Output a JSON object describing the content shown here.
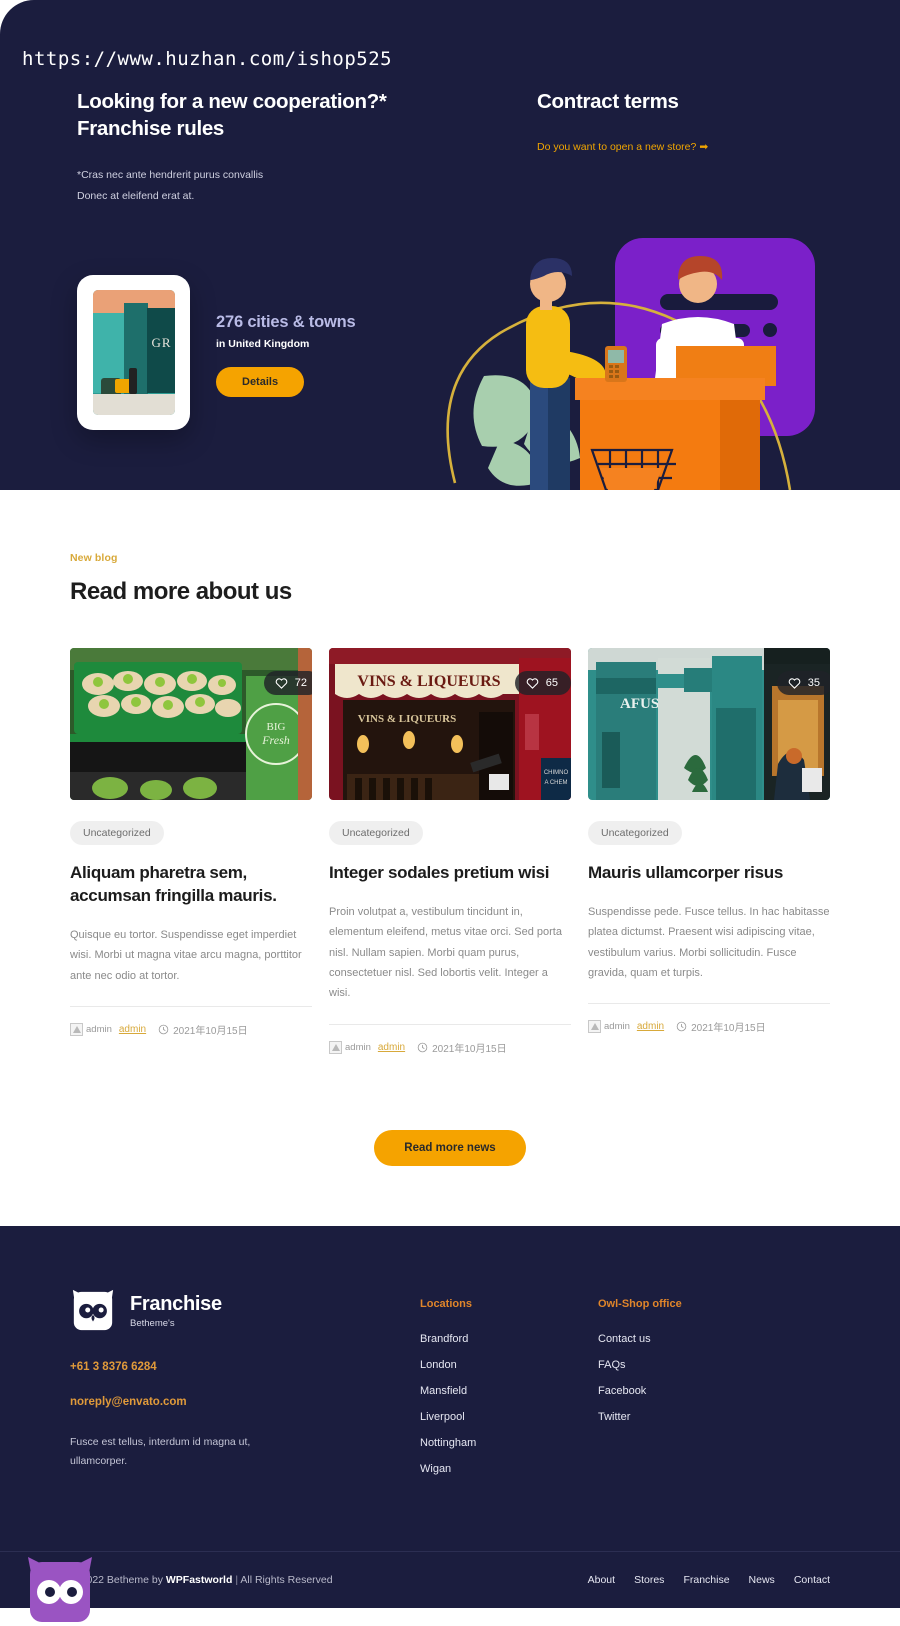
{
  "hero": {
    "url": "https://www.huzhan.com/ishop525",
    "col_a": {
      "heading": "Looking for a new cooperation?* Franchise rules",
      "sub_line1": "*Cras nec ante hendrerit purus convallis",
      "sub_line2": "Donec at eleifend erat at."
    },
    "col_b": {
      "heading": "Contract terms",
      "link": "Do you want to open a new store?",
      "arrow": "➡"
    },
    "stat": {
      "number": "276 cities & towns",
      "country": "in United Kingdom",
      "button": "Details",
      "photo_text": "GR"
    }
  },
  "blog": {
    "eyebrow": "New blog",
    "title": "Read more about us",
    "more_button": "Read more news",
    "cards": [
      {
        "likes": "72",
        "heart_icon": "heart-icon",
        "category": "Uncategorized",
        "title": "Aliquam pharetra sem, accumsan fringilla mauris.",
        "excerpt": "Quisque eu tortor. Suspendisse eget imperdiet wisi. Morbi ut magna vitae arcu magna, porttitor ante nec odio at tortor.",
        "avatar_alt": "admin",
        "author": "admin",
        "date": "2021年10月15日",
        "clock_icon": "clock-icon"
      },
      {
        "likes": "65",
        "heart_icon": "heart-icon",
        "category": "Uncategorized",
        "title": "Integer sodales pretium wisi",
        "excerpt": "Proin volutpat a, vestibulum tincidunt in, elementum eleifend, metus vitae orci. Sed porta nisl. Nullam sapien. Morbi quam purus, consectetuer nisl. Sed lobortis velit. Integer a wisi.",
        "avatar_alt": "admin",
        "author": "admin",
        "date": "2021年10月15日",
        "clock_icon": "clock-icon"
      },
      {
        "likes": "35",
        "heart_icon": "heart-icon",
        "category": "Uncategorized",
        "title": "Mauris ullamcorper risus",
        "excerpt": "Suspendisse pede. Fusce tellus. In hac habitasse platea dictumst. Praesent wisi adipiscing vitae, vestibulum varius. Morbi sollicitudin. Fusce gravida, quam et turpis.",
        "avatar_alt": "admin",
        "author": "admin",
        "date": "2021年10月15日",
        "clock_icon": "clock-icon"
      }
    ]
  },
  "footer": {
    "brand_name": "Franchise",
    "brand_tag": "Betheme's",
    "phone": "+61 3 8376 6284",
    "email": "noreply@envato.com",
    "description": "Fusce est tellus, interdum id magna ut, ullamcorper.",
    "columns": [
      {
        "heading": "Locations",
        "items": [
          "Brandford",
          "London",
          "Mansfield",
          "Liverpool",
          "Nottingham",
          "Wigan"
        ]
      },
      {
        "heading": "Owl-Shop office",
        "items": [
          "Contact us",
          "FAQs",
          "Facebook",
          "Twitter"
        ]
      }
    ],
    "copyright_pre": "© 2022 Betheme by ",
    "copyright_brand": "WPFastworld",
    "copyright_sep": " | ",
    "copyright_post": "All Rights Reserved",
    "nav": [
      "About",
      "Stores",
      "Franchise",
      "News",
      "Contact"
    ]
  },
  "colors": {
    "navy": "#1b1d3e",
    "orange": "#f5a300",
    "purple": "#7b20c9",
    "gold_text": "#d8a93a"
  }
}
